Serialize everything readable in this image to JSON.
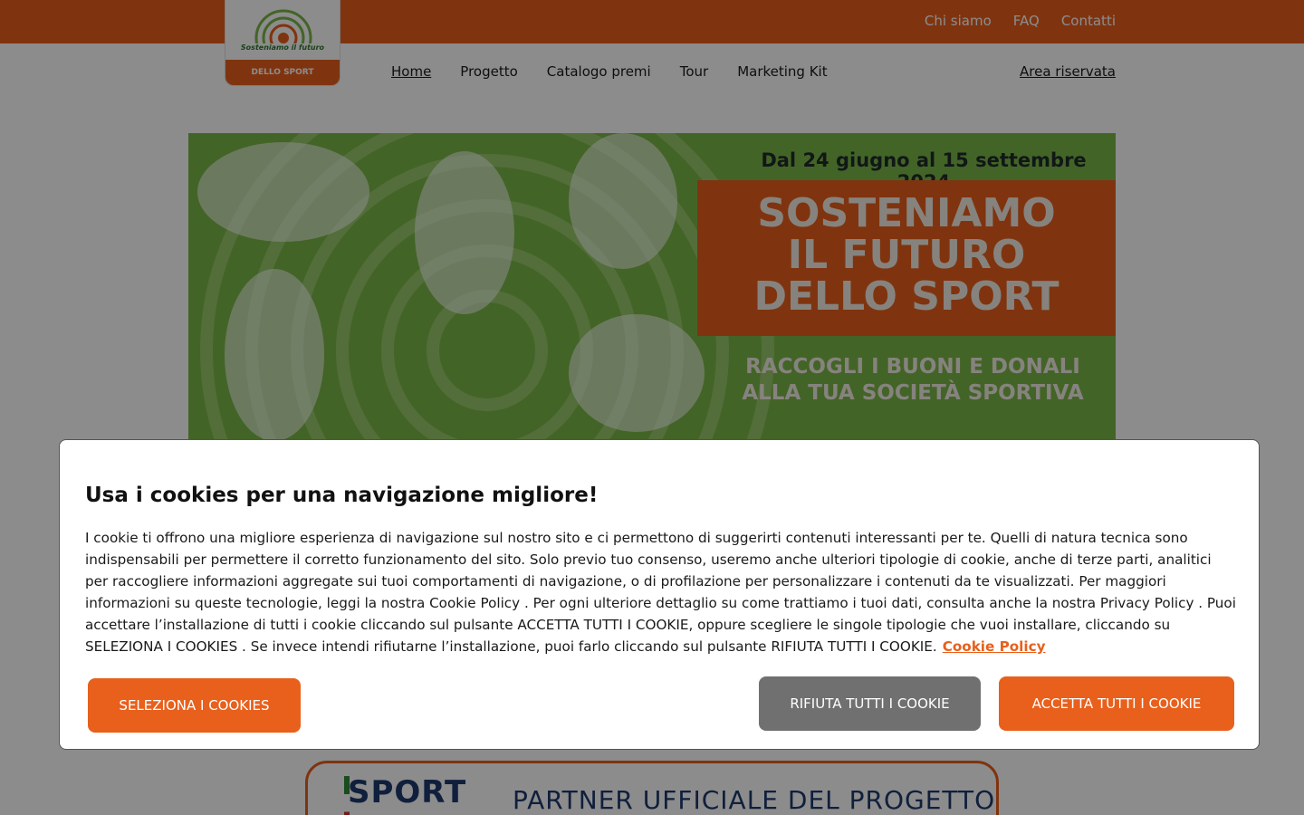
{
  "header": {
    "top_links": [
      "Chi siamo",
      "FAQ",
      "Contatti"
    ],
    "logo": {
      "line1": "Sosteniamo il futuro",
      "line2": "DELLO SPORT"
    },
    "nav": [
      "Home",
      "Progetto",
      "Catalogo premi",
      "Tour",
      "Marketing Kit"
    ],
    "area_riservata": "Area riservata"
  },
  "hero": {
    "date": "Dal 24 giugno al 15 settembre 2024",
    "title_lines": [
      "SOSTENIAMO",
      "IL FUTURO",
      "DELLO SPORT"
    ],
    "sub_lines": [
      "RACCOGLI I BUONI E DONALI",
      "ALLA TUA SOCIETÀ SPORTIVA"
    ]
  },
  "partner": {
    "logo": "SPORT",
    "text": "PARTNER UFFICIALE DEL PROGETTO"
  },
  "cookie": {
    "title": "Usa i cookies per una navigazione migliore!",
    "body": "I cookie ti offrono una migliore esperienza di navigazione sul nostro sito e ci permettono di suggerirti contenuti interessanti per te. Quelli di natura tecnica sono indispensabili per permettere il corretto funzionamento del sito. Solo previo tuo consenso, useremo anche ulteriori tipologie di cookie, anche di terze parti, analitici per raccogliere informazioni aggregate sui tuoi comportamenti di navigazione, o di profilazione per personalizzare i contenuti da te visualizzati. Per maggiori informazioni su queste tecnologie, leggi la nostra Cookie Policy . Per ogni ulteriore dettaglio su come trattiamo i tuoi dati, consulta anche la nostra Privacy Policy . Puoi accettare l’installazione di tutti i cookie cliccando sul pulsante ACCETTA TUTTI I COOKIE, oppure scegliere le singole tipologie che vuoi installare, cliccando su SELEZIONA I COOKIES . Se invece intendi rifiutarne l’installazione, puoi farlo cliccando sul pulsante RIFIUTA TUTTI I COOKIE.",
    "link": "Cookie Policy",
    "btn_select": "SELEZIONA I COOKIES",
    "btn_reject": "RIFIUTA TUTTI I COOKIE",
    "btn_accept": "ACCETTA TUTTI I COOKIE"
  },
  "colors": {
    "brand_orange": "#e8601c",
    "hero_green": "#7ab648",
    "reject_gray": "#707070"
  }
}
